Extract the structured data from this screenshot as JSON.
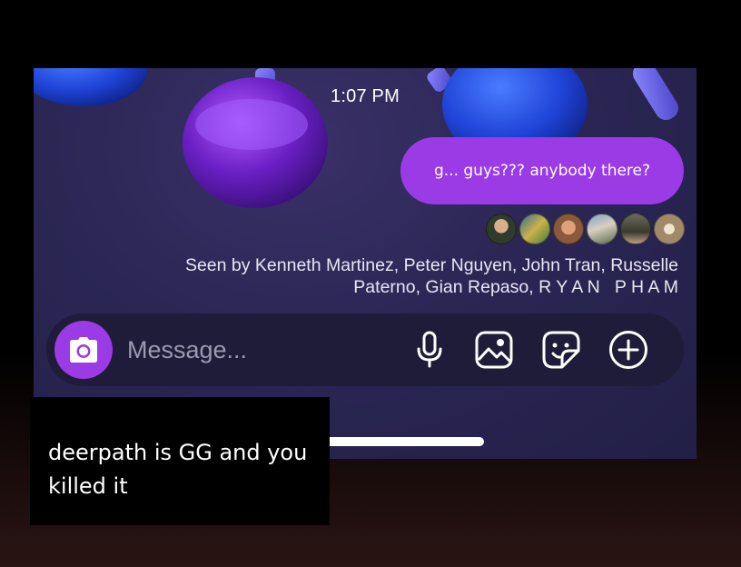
{
  "chat": {
    "timestamp": "1:07 PM",
    "message": "g... guys??? anybody there?",
    "seen_line1": "Seen by Kenneth Martinez, Peter Nguyen, John Tran, Russelle",
    "seen_line2": "Paterno, Gian Repaso, R Y A N   P H A M",
    "avatars": [
      "avatar",
      "avatar",
      "avatar",
      "avatar",
      "avatar",
      "avatar"
    ]
  },
  "composer": {
    "placeholder": "Message...",
    "icons": [
      "camera-icon",
      "microphone-icon",
      "image-icon",
      "sticker-icon",
      "add-icon"
    ]
  },
  "caption": {
    "text": "deerpath is GG and you killed it"
  },
  "colors": {
    "accent": "#9a3be6",
    "chat_background": "#2b2654",
    "composer_background": "#1e1c38"
  }
}
